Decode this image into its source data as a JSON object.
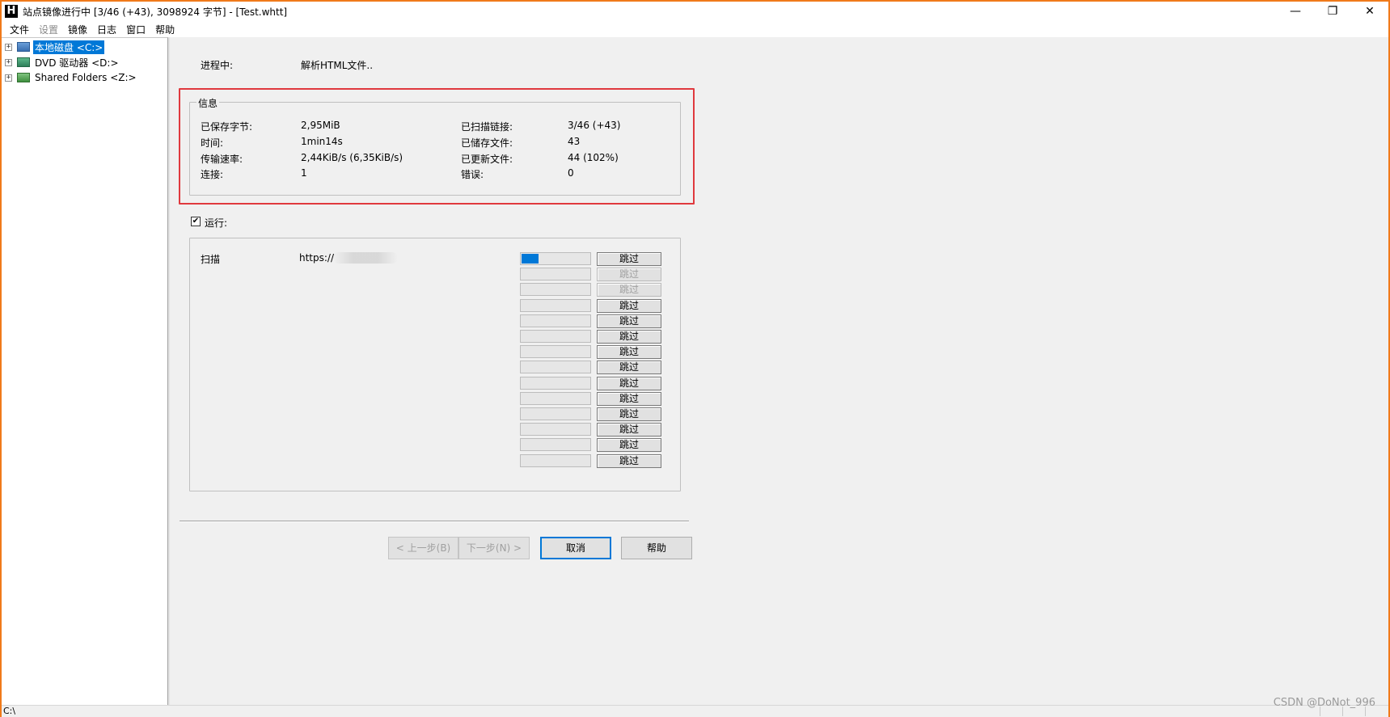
{
  "window": {
    "title": "站点镜像进行中 [3/46 (+43), 3098924 字节] - [Test.whtt]",
    "app_logo": "H",
    "controls": {
      "minimize": "—",
      "maximize": "❐",
      "close": "✕"
    }
  },
  "menu": {
    "items": [
      {
        "label": "文件",
        "enabled": true
      },
      {
        "label": "设置",
        "enabled": false
      },
      {
        "label": "镜像",
        "enabled": true
      },
      {
        "label": "日志",
        "enabled": true
      },
      {
        "label": "窗口",
        "enabled": true
      },
      {
        "label": "帮助",
        "enabled": true
      }
    ]
  },
  "tree": {
    "items": [
      {
        "label": "本地磁盘 <C:>",
        "icon": "hard-drive-icon",
        "selected": true
      },
      {
        "label": "DVD 驱动器 <D:>",
        "icon": "dvd-drive-icon",
        "selected": false
      },
      {
        "label": "Shared Folders <Z:>",
        "icon": "network-drive-icon",
        "selected": false
      }
    ],
    "expander": "+"
  },
  "progress": {
    "label": "进程中:",
    "value": "解析HTML文件.."
  },
  "info": {
    "title": "信息",
    "left": [
      {
        "label": "已保存字节:",
        "value": "2,95MiB"
      },
      {
        "label": "时间:",
        "value": "1min14s"
      },
      {
        "label": "传输速率:",
        "value": "2,44KiB/s (6,35KiB/s)"
      },
      {
        "label": "连接:",
        "value": "1"
      }
    ],
    "right": [
      {
        "label": "已扫描链接:",
        "value": "3/46 (+43)"
      },
      {
        "label": "已储存文件:",
        "value": "43"
      },
      {
        "label": "已更新文件:",
        "value": "44 (102%)"
      },
      {
        "label": "错误:",
        "value": "0"
      }
    ]
  },
  "running": {
    "checkbox_label": "运行:",
    "checked": true,
    "check_glyph": "✔",
    "scan_label": "扫描",
    "scan_url": "https://",
    "skip_label": "跳过",
    "slots": [
      {
        "progress": 0.25,
        "skip_enabled": true
      },
      {
        "progress": 0,
        "skip_enabled": false
      },
      {
        "progress": 0,
        "skip_enabled": false
      },
      {
        "progress": 0,
        "skip_enabled": true
      },
      {
        "progress": 0,
        "skip_enabled": true
      },
      {
        "progress": 0,
        "skip_enabled": true
      },
      {
        "progress": 0,
        "skip_enabled": true
      },
      {
        "progress": 0,
        "skip_enabled": true
      },
      {
        "progress": 0,
        "skip_enabled": true
      },
      {
        "progress": 0,
        "skip_enabled": true
      },
      {
        "progress": 0,
        "skip_enabled": true
      },
      {
        "progress": 0,
        "skip_enabled": true
      },
      {
        "progress": 0,
        "skip_enabled": true
      },
      {
        "progress": 0,
        "skip_enabled": true
      }
    ]
  },
  "buttons": {
    "back": "< 上一步(B)",
    "next": "下一步(N) >",
    "cancel": "取消",
    "help": "帮助"
  },
  "status": {
    "text": "C:\\"
  },
  "watermark": "CSDN @DoNot_996",
  "colors": {
    "accent": "#0078d7",
    "highlight": "#e0393e",
    "window_border": "#f07a1a"
  }
}
